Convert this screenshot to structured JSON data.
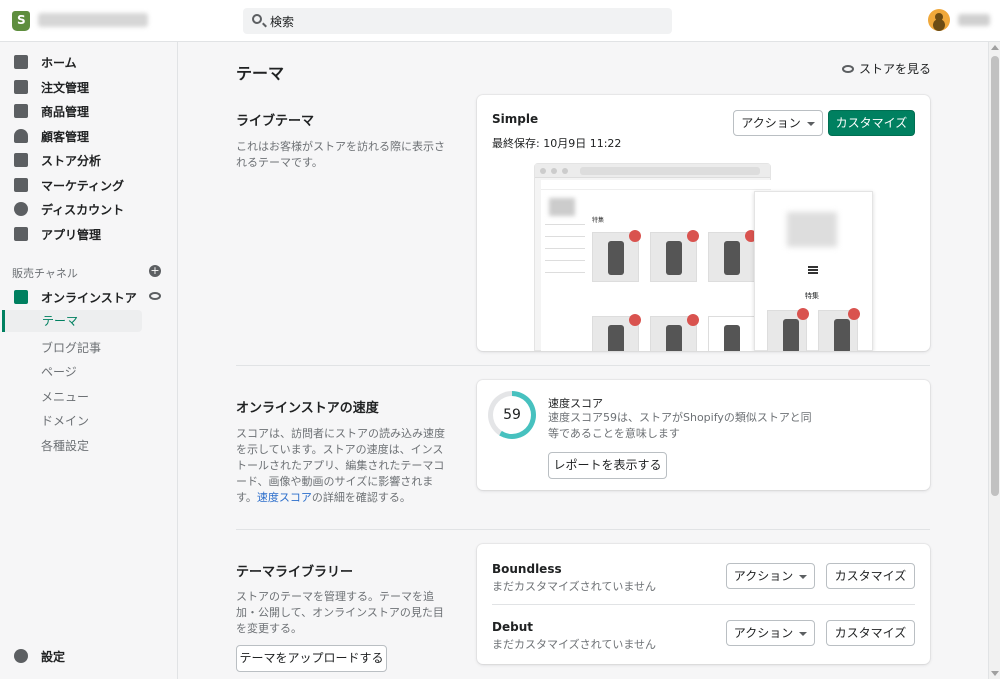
{
  "topbar": {
    "search_placeholder": "検索"
  },
  "sidebar": {
    "items": [
      {
        "label": "ホーム"
      },
      {
        "label": "注文管理"
      },
      {
        "label": "商品管理"
      },
      {
        "label": "顧客管理"
      },
      {
        "label": "ストア分析"
      },
      {
        "label": "マーケティング"
      },
      {
        "label": "ディスカウント"
      },
      {
        "label": "アプリ管理"
      }
    ],
    "channels_label": "販売チャネル",
    "online_store": "オンラインストア",
    "sub_items": [
      "テーマ",
      "ブログ記事",
      "ページ",
      "メニュー",
      "ドメイン",
      "各種設定"
    ],
    "settings": "設定"
  },
  "main": {
    "page_title": "テーマ",
    "view_store": "ストアを見る",
    "live": {
      "title": "ライブテーマ",
      "desc": "これはお客様がストアを訪れる際に表示されるテーマです。",
      "theme_name": "Simple",
      "saved": "最終保存: 10月9日 11:22",
      "actions_label": "アクション",
      "customize_label": "カスタマイズ",
      "preview_feature": "特集"
    },
    "speed": {
      "title": "オンラインストアの速度",
      "desc": "スコアは、訪問者にストアの読み込み速度を示しています。ストアの速度は、インストールされたアプリ、編集されたテーマコード、画像や動画のサイズに影響されます。",
      "link": "速度スコア",
      "desc_after": "の詳細を確認する。",
      "score": "59",
      "score_title": "速度スコア",
      "score_text": "速度スコア59は、ストアがShopifyの類似ストアと同等であることを意味します",
      "report_button": "レポートを表示する"
    },
    "library": {
      "title": "テーマライブラリー",
      "desc": "ストアのテーマを管理する。テーマを追加・公開して、オンラインストアの見た目を変更する。",
      "upload_button": "テーマをアップロードする",
      "themes": [
        {
          "name": "Boundless",
          "status": "まだカスタマイズされていません",
          "actions": "アクション",
          "customize": "カスタマイズ"
        },
        {
          "name": "Debut",
          "status": "まだカスタマイズされていません",
          "actions": "アクション",
          "customize": "カスタマイズ"
        }
      ]
    }
  }
}
